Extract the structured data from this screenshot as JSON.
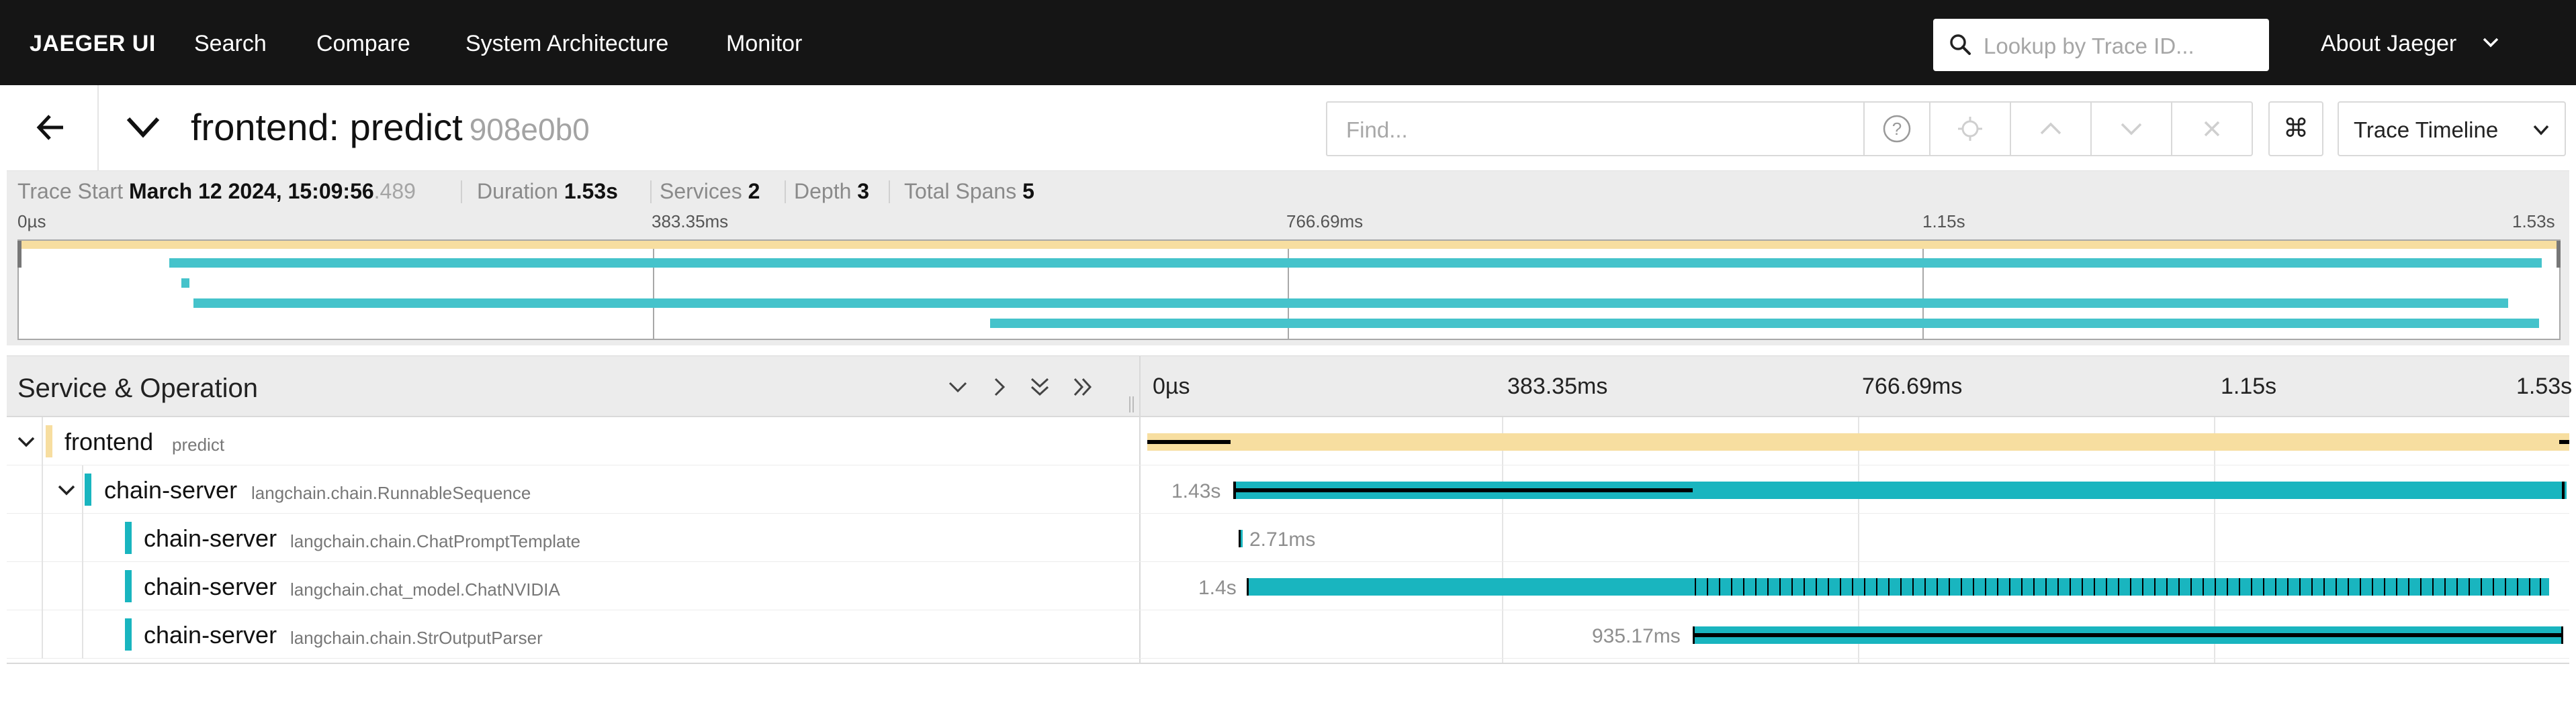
{
  "nav": {
    "brand": "JAEGER UI",
    "items": [
      "Search",
      "Compare",
      "System Architecture",
      "Monitor"
    ],
    "lookup_placeholder": "Lookup by Trace ID...",
    "about": "About Jaeger"
  },
  "trace": {
    "title": "frontend: predict",
    "trace_id": "908e0b0",
    "find_placeholder": "Find...",
    "view_select": "Trace Timeline",
    "kbd_icon": "⌘"
  },
  "summary": {
    "trace_start_label": "Trace Start",
    "trace_start_value": "March 12 2024, 15:09:56",
    "trace_start_ms": ".489",
    "duration_label": "Duration",
    "duration_value": "1.53s",
    "services_label": "Services",
    "services_value": "2",
    "depth_label": "Depth",
    "depth_value": "3",
    "total_spans_label": "Total Spans",
    "total_spans_value": "5"
  },
  "minimap": {
    "ticks": [
      "0µs",
      "383.35ms",
      "766.69ms",
      "1.15s",
      "1.53s"
    ]
  },
  "timeline": {
    "header_title": "Service & Operation",
    "ticks": [
      "0µs",
      "383.35ms",
      "766.69ms",
      "1.15s",
      "1.53s"
    ],
    "spans": [
      {
        "service": "frontend",
        "operation": "predict",
        "duration_label": ""
      },
      {
        "service": "chain-server",
        "operation": "langchain.chain.RunnableSequence",
        "duration_label": "1.43s"
      },
      {
        "service": "chain-server",
        "operation": "langchain.chain.ChatPromptTemplate",
        "duration_label": "2.71ms"
      },
      {
        "service": "chain-server",
        "operation": "langchain.chat_model.ChatNVIDIA",
        "duration_label": "1.4s"
      },
      {
        "service": "chain-server",
        "operation": "langchain.chain.StrOutputParser",
        "duration_label": "935.17ms"
      }
    ]
  },
  "colors": {
    "frontend": "#f7dea0",
    "chain_server": "#19b5bf",
    "nav_bg": "#151515"
  }
}
